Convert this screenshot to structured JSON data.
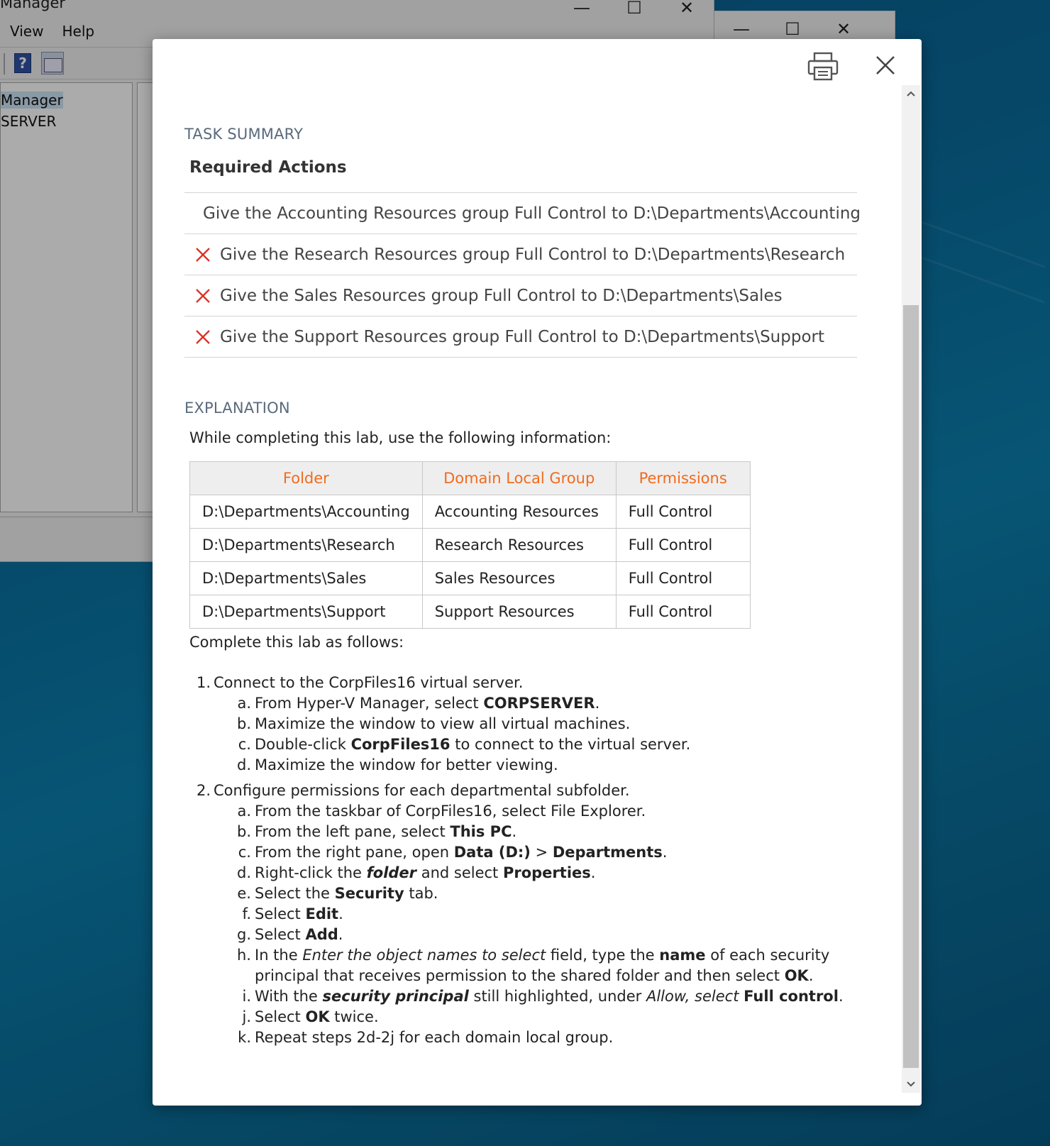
{
  "background": {
    "hyperv": {
      "title": "Manager",
      "menus": [
        "View",
        "Help"
      ],
      "tree_items": [
        "Manager",
        "SERVER"
      ]
    },
    "caption_buttons": {
      "min": "—",
      "max": "☐",
      "close": "✕"
    }
  },
  "modal": {
    "task_summary_label": "TASK SUMMARY",
    "required_actions_label": "Required Actions",
    "actions": [
      "Give the Accounting Resources group Full Control to D:\\Departments\\Accounting",
      "Give the Research Resources group Full Control to D:\\Departments\\Research",
      "Give the Sales Resources group Full Control to D:\\Departments\\Sales",
      "Give the Support Resources group Full Control to D:\\Departments\\Support"
    ],
    "explanation_label": "EXPLANATION",
    "intro": "While completing this lab, use the following information:",
    "table": {
      "headers": [
        "Folder",
        "Domain Local Group",
        "Permissions"
      ],
      "rows": [
        [
          "D:\\Departments\\Accounting",
          "Accounting Resources",
          "Full Control"
        ],
        [
          "D:\\Departments\\Research",
          "Research Resources",
          "Full Control"
        ],
        [
          "D:\\Departments\\Sales",
          "Sales Resources",
          "Full Control"
        ],
        [
          "D:\\Departments\\Support",
          "Support Resources",
          "Full Control"
        ]
      ]
    },
    "complete_label": "Complete this lab as follows:",
    "steps": {
      "s1": {
        "num": "1.",
        "text": "Connect to the CorpFiles16 virtual server.",
        "a": {
          "l": "a.",
          "t1": "From Hyper-V Manager, select ",
          "b1": "CORPSERVER",
          "t2": "."
        },
        "b": {
          "l": "b.",
          "t1": "Maximize the window to view all virtual machines."
        },
        "c": {
          "l": "c.",
          "t1": "Double-click ",
          "b1": "CorpFiles16",
          "t2": " to connect to the virtual server."
        },
        "d": {
          "l": "d.",
          "t1": "Maximize the window for better viewing."
        }
      },
      "s2": {
        "num": "2.",
        "text": "Configure permissions for each departmental subfolder.",
        "a": {
          "l": "a.",
          "t1": "From the taskbar of CorpFiles16, select File Explorer."
        },
        "b": {
          "l": "b.",
          "t1": "From the left pane, select ",
          "b1": "This PC",
          "t2": "."
        },
        "c": {
          "l": "c.",
          "t1": "From the right pane, open ",
          "b1": "Data (D:)",
          "t2": " > ",
          "b2": "Departments",
          "t3": "."
        },
        "d": {
          "l": "d.",
          "t1": "Right-click the ",
          "bi1": "folder",
          "t2": " and select ",
          "b1": "Properties",
          "t3": "."
        },
        "e": {
          "l": "e.",
          "t1": "Select the ",
          "b1": "Security",
          "t2": " tab."
        },
        "f": {
          "l": "f.",
          "t1": "Select ",
          "b1": "Edit",
          "t2": "."
        },
        "g": {
          "l": "g.",
          "t1": "Select ",
          "b1": "Add",
          "t2": "."
        },
        "h": {
          "l": "h.",
          "t1": "In the ",
          "i1": "Enter the object names to select",
          "t2": " field, type the ",
          "b1": "name",
          "t3": " of each security principal that receives permission to the shared folder and then select ",
          "b2": "OK",
          "t4": "."
        },
        "i": {
          "l": "i.",
          "t1": "With the ",
          "bi1": "security principal",
          "t2": " still highlighted, under ",
          "i1": "Allow, select",
          "t3": " ",
          "b1": "Full control",
          "t4": "."
        },
        "j": {
          "l": "j.",
          "t1": "Select ",
          "b1": "OK",
          "t2": " twice."
        },
        "k": {
          "l": "k.",
          "t1": "Repeat steps 2d-2j for each domain local group."
        }
      }
    }
  },
  "colors": {
    "header_text": "#f26b1d",
    "fail_x": "#d9352a",
    "section_label": "#5a6a7d"
  },
  "icons": [
    "print-icon",
    "close-icon",
    "fail-x-icon",
    "scroll-up-arrow-icon",
    "scroll-down-arrow-icon"
  ]
}
